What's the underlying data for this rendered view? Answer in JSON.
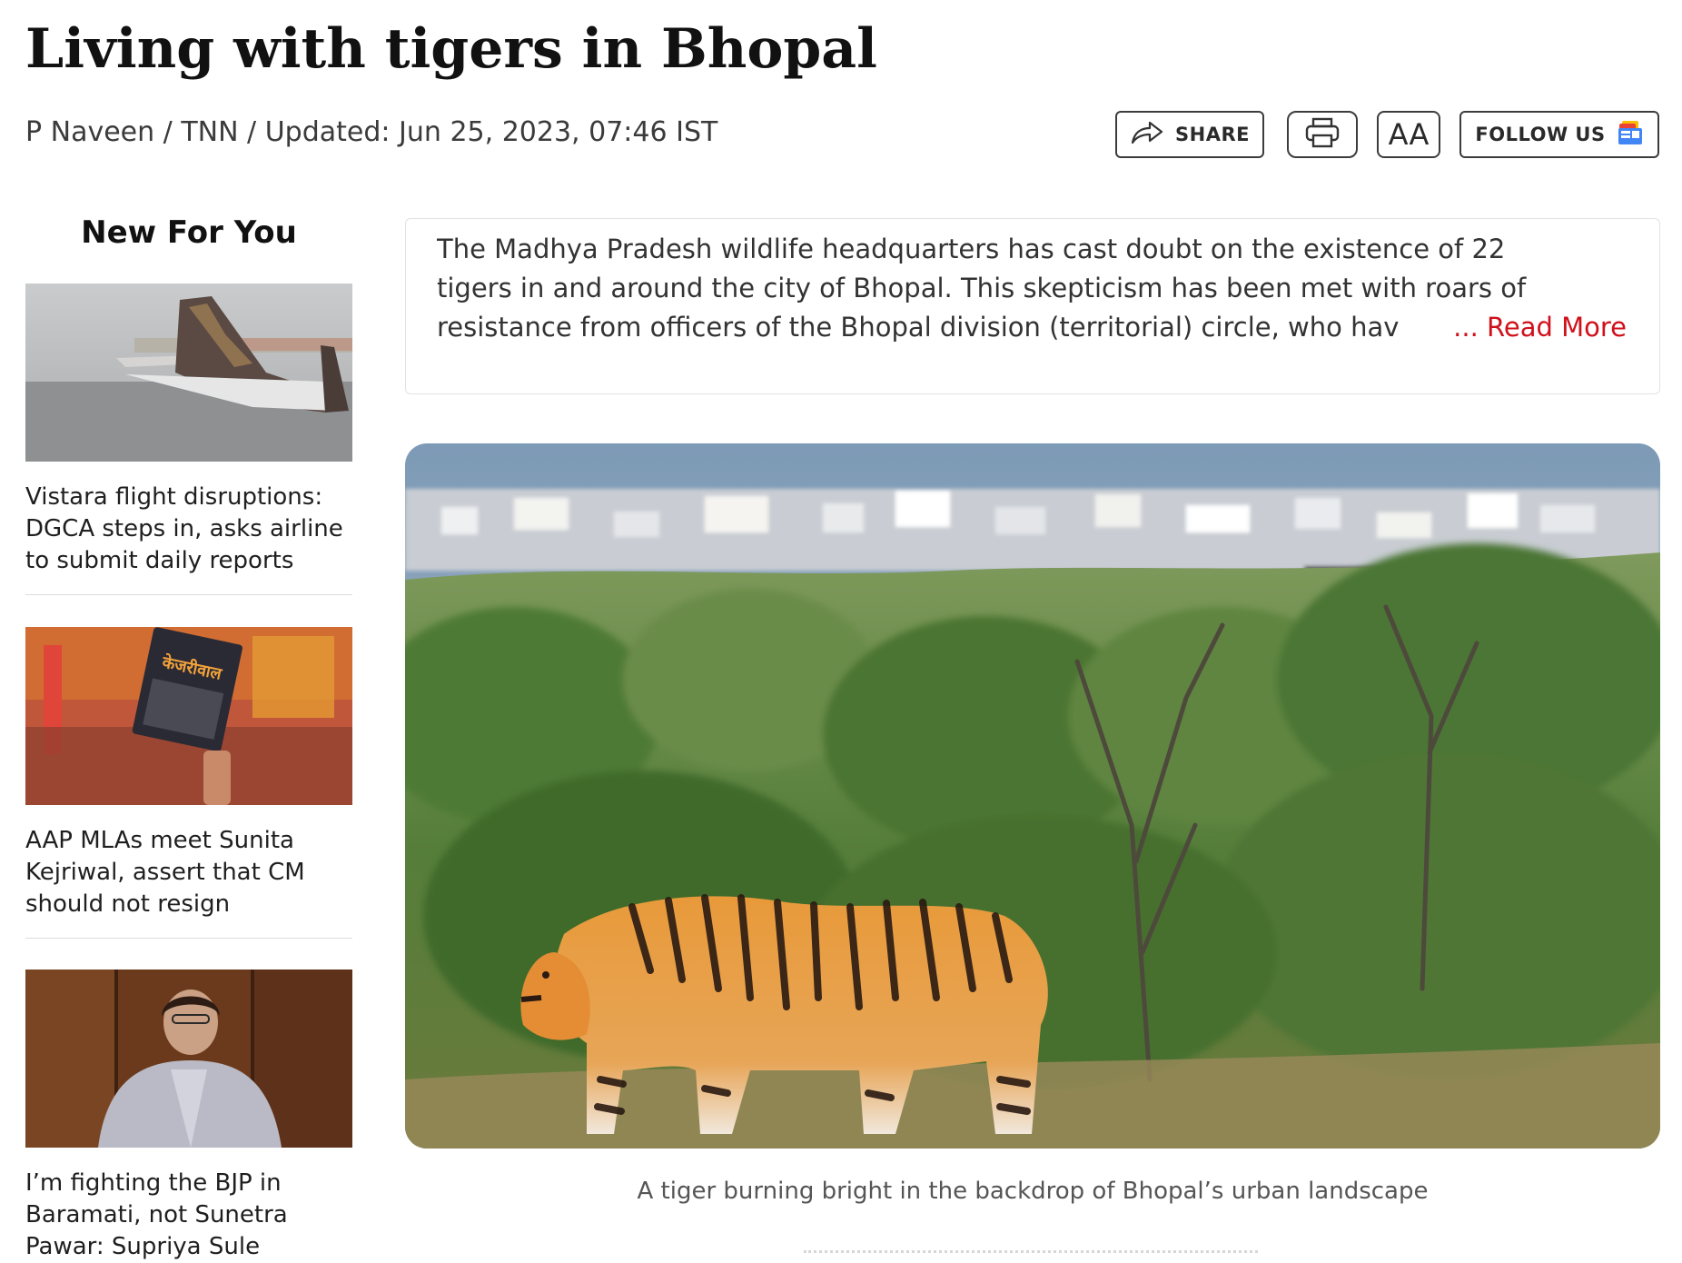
{
  "article": {
    "headline": "Living with tigers in Bhopal",
    "byline": "P Naveen / TNN / Updated: Jun 25, 2023, 07:46 IST"
  },
  "toolbar": {
    "share_label": "SHARE",
    "font_size_label": "AA",
    "follow_label": "FOLLOW US",
    "icons": [
      "share-arrow-icon",
      "print-icon",
      "google-news-icon"
    ]
  },
  "sidebar": {
    "title": "New For You",
    "stories": [
      {
        "title": "Vistara flight disruptions: DGCA steps in, asks airline to submit daily reports",
        "image": "airplane-tail-photo"
      },
      {
        "title": "AAP MLAs meet Sunita Kejriwal, assert that CM should not resign",
        "image": "protest-poster-photo",
        "poster_text": "केजरीवाल"
      },
      {
        "title": "I’m fighting the BJP in Baramati, not Sunetra Pawar: Supriya Sule",
        "image": "woman-portrait-photo"
      }
    ]
  },
  "summary": {
    "text": "The Madhya Pradesh wildlife headquarters has cast doubt on the existence of 22 tigers in and around the city of Bhopal. This skepticism has been met with roars of resistance from officers of the Bhopal division (territorial) circle, who hav",
    "read_more": "... Read More"
  },
  "hero": {
    "image": "tiger-in-forest-photo",
    "caption": "A tiger burning bright in the backdrop of Bhopal’s urban landscape"
  },
  "colors": {
    "accent": "#d0101b",
    "text": "#1a1a1a",
    "muted": "#555555"
  }
}
